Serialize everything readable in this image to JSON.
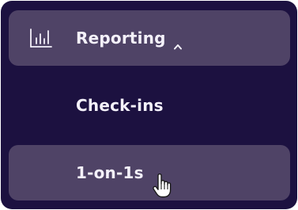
{
  "nav": {
    "items": [
      {
        "label": "Reporting",
        "icon": "bar-chart-icon",
        "expanded": true,
        "highlighted": true
      },
      {
        "label": "Check-ins",
        "highlighted": false
      },
      {
        "label": "1-on-1s",
        "highlighted": true,
        "hovered": true
      }
    ]
  },
  "colors": {
    "panel_bg": "#1c1140",
    "highlight_bg": "#4f4366",
    "text": "#f4f1fa"
  },
  "cursor": {
    "type": "pointer-hand"
  }
}
